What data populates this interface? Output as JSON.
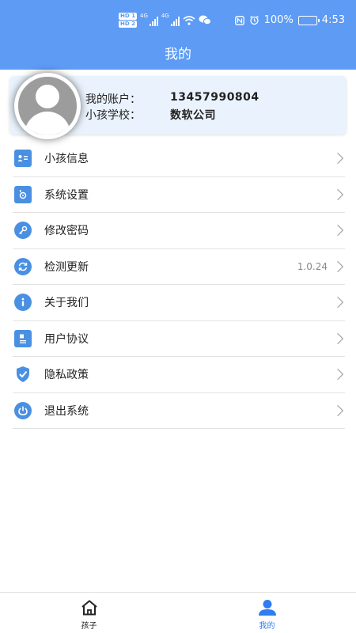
{
  "statusbar": {
    "hd1": "HD 1",
    "hd2": "HD 2",
    "net1": "4G",
    "net2": "4G",
    "battery": "100%",
    "time": "4:53"
  },
  "header": {
    "title": "我的"
  },
  "account": {
    "account_label": "我的账户：",
    "account_value": "13457990804",
    "school_label": "小孩学校：",
    "school_value": "数软公司"
  },
  "menu": {
    "items": [
      {
        "label": "小孩信息",
        "icon": "id-card-icon"
      },
      {
        "label": "系统设置",
        "icon": "settings-icon"
      },
      {
        "label": "修改密码",
        "icon": "key-icon"
      },
      {
        "label": "检测更新",
        "icon": "refresh-icon",
        "value": "1.0.24"
      },
      {
        "label": "关于我们",
        "icon": "info-icon"
      },
      {
        "label": "用户协议",
        "icon": "document-icon"
      },
      {
        "label": "隐私政策",
        "icon": "shield-icon"
      },
      {
        "label": "退出系统",
        "icon": "power-icon"
      }
    ]
  },
  "tabbar": {
    "tabs": [
      {
        "label": "孩子",
        "icon": "home-icon",
        "active": false
      },
      {
        "label": "我的",
        "icon": "user-icon",
        "active": true
      }
    ]
  },
  "colors": {
    "header": "#5d9bf4",
    "accent": "#2f7df0",
    "card": "#eaf3fd"
  }
}
